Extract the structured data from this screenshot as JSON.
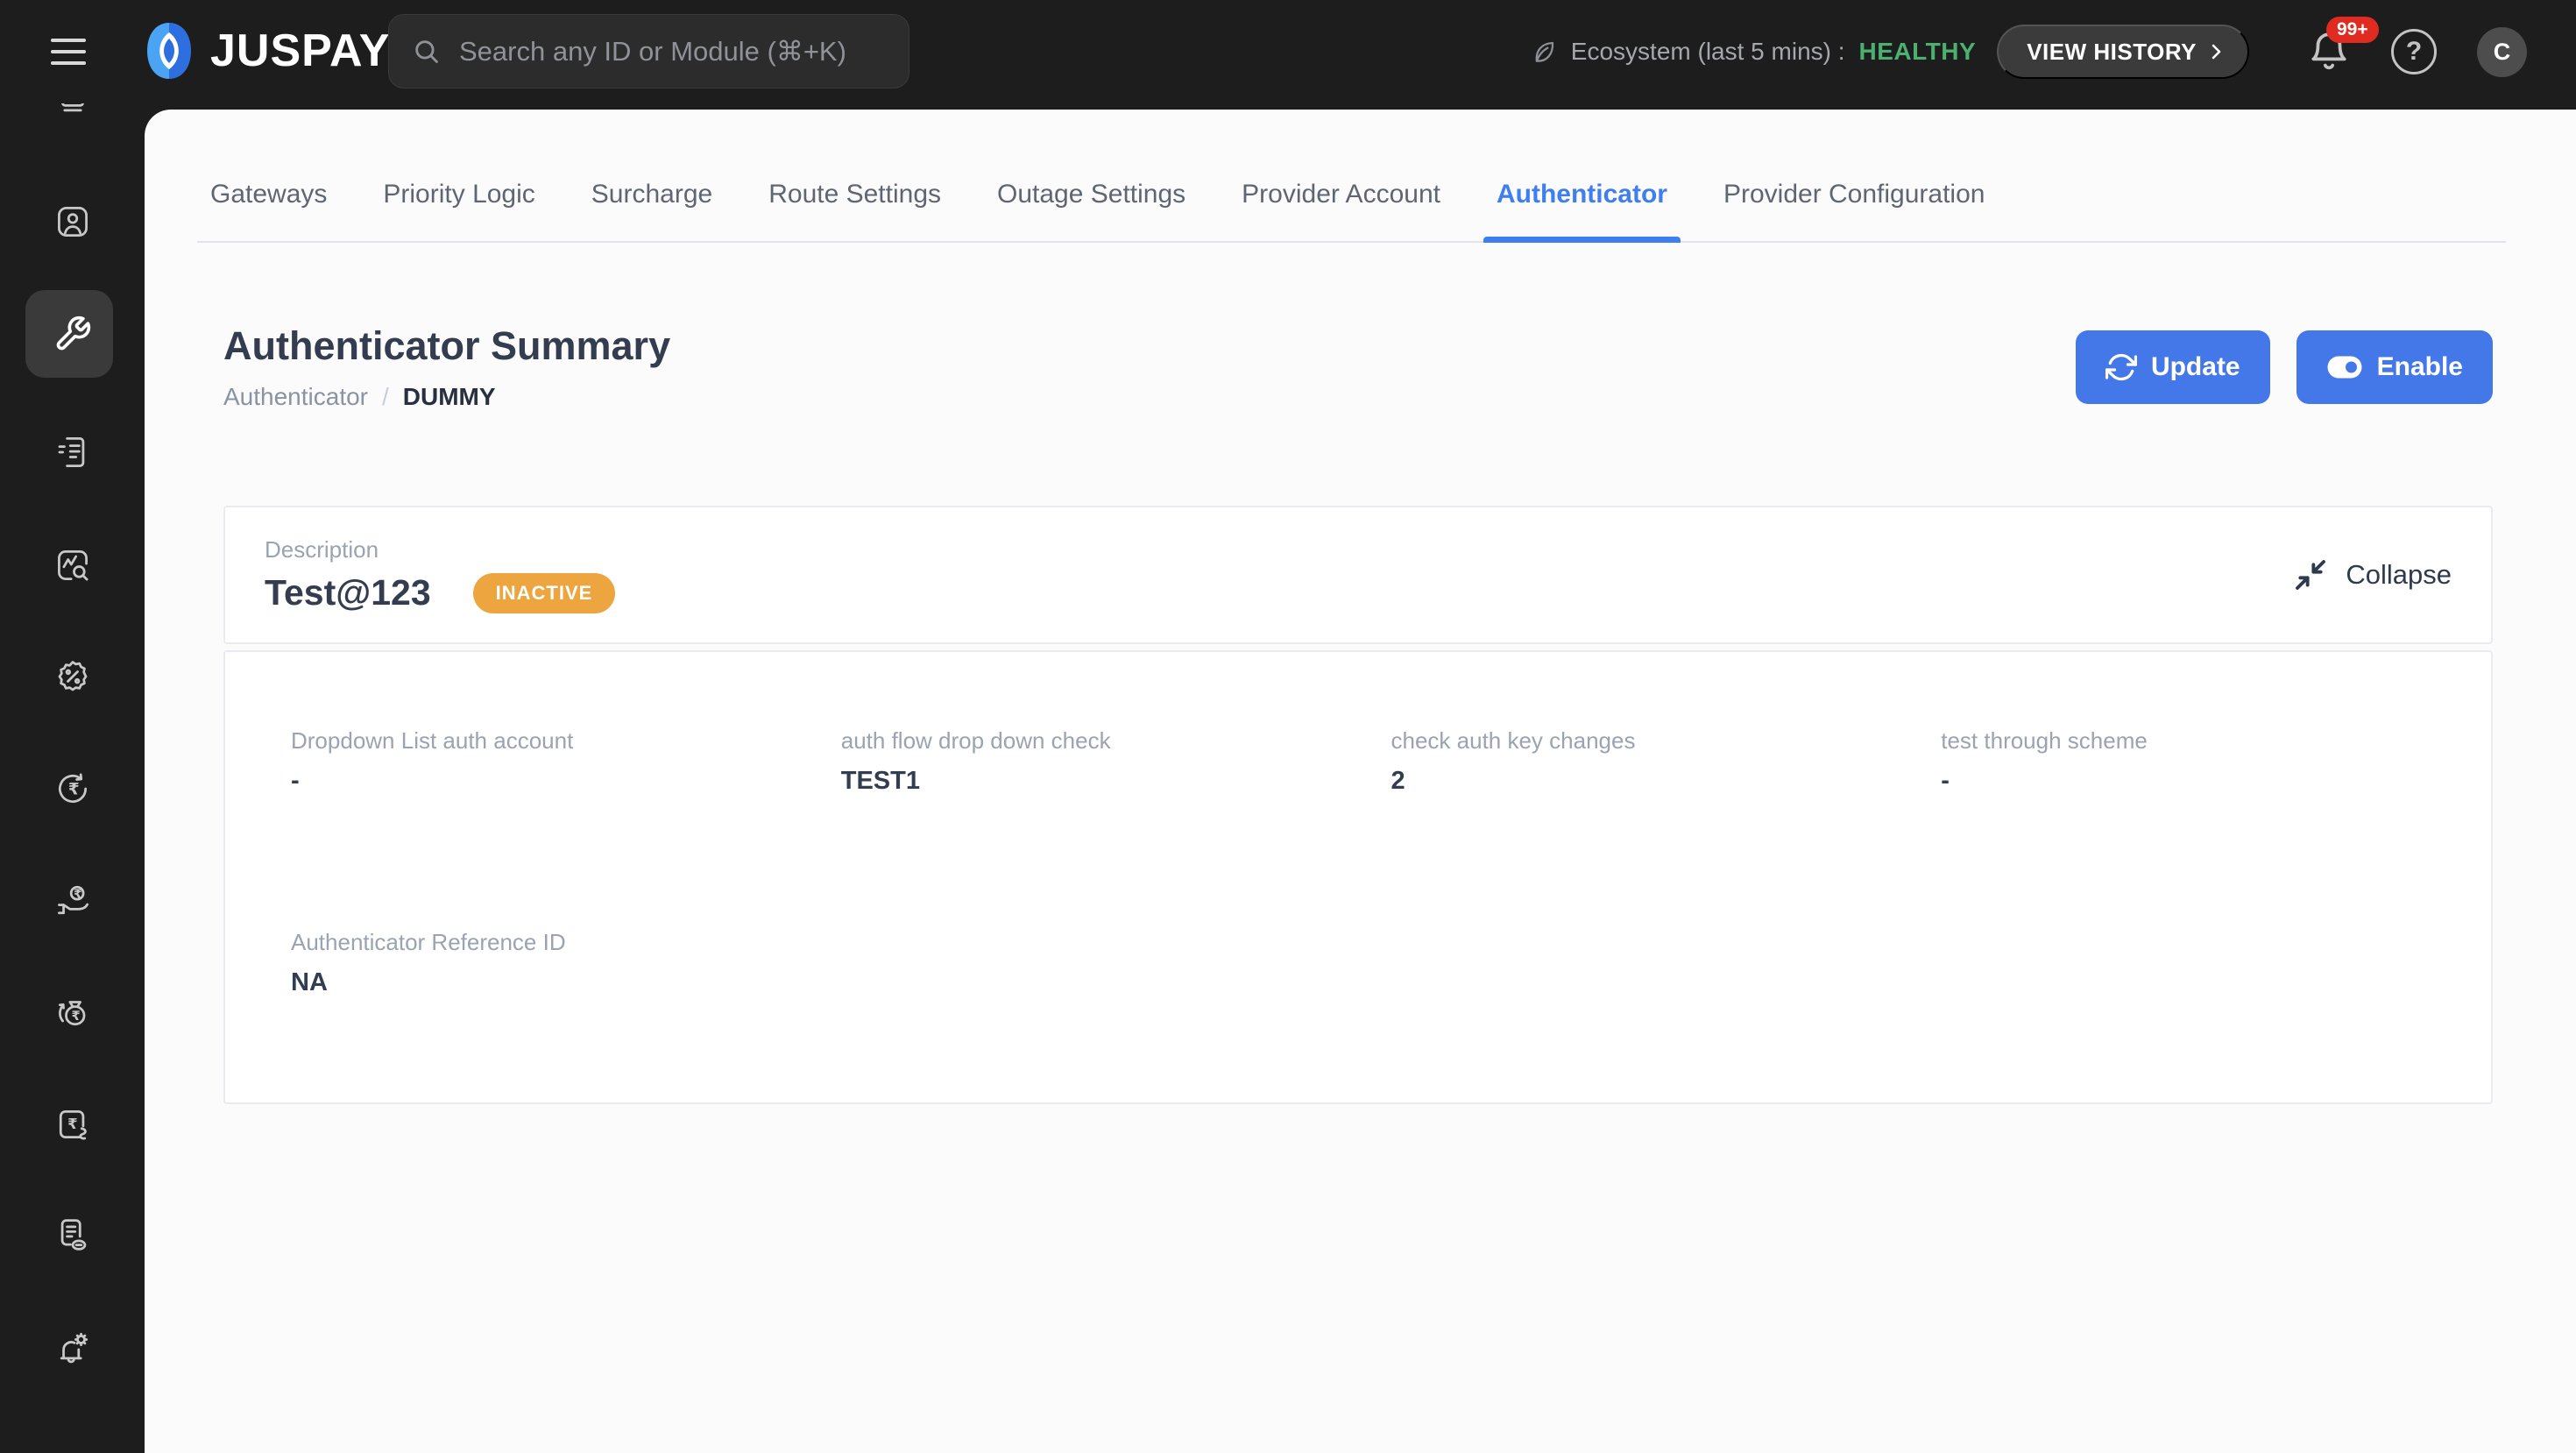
{
  "header": {
    "logo_text": "JUSPAY",
    "search": {
      "placeholder": "Search any ID or Module (⌘+K)"
    },
    "ecosystem": {
      "label": "Ecosystem (last 5 mins) :",
      "status": "HEALTHY",
      "view_history_label": "VIEW HISTORY"
    },
    "notifications_badge": "99+",
    "help_glyph": "?",
    "avatar_initial": "C"
  },
  "sidebar": {
    "items": [
      {
        "icon": "pos-terminal",
        "active": false
      },
      {
        "icon": "user-card",
        "active": false
      },
      {
        "icon": "wrench",
        "active": true
      },
      {
        "icon": "form-doc",
        "active": false
      },
      {
        "icon": "analytics-search",
        "active": false
      },
      {
        "icon": "percent-badge",
        "active": false
      },
      {
        "icon": "rupee-refresh",
        "active": false
      },
      {
        "icon": "hand-rupee",
        "active": false
      },
      {
        "icon": "money-bag-rupee",
        "active": false
      },
      {
        "icon": "rupee-doc-link",
        "active": false
      },
      {
        "icon": "doc-link",
        "active": false
      },
      {
        "icon": "bell-gear",
        "active": false
      }
    ]
  },
  "tabs": {
    "active": "Authenticator",
    "items": [
      {
        "label": "Gateways"
      },
      {
        "label": "Priority Logic"
      },
      {
        "label": "Surcharge"
      },
      {
        "label": "Route Settings"
      },
      {
        "label": "Outage Settings"
      },
      {
        "label": "Provider Account"
      },
      {
        "label": "Authenticator"
      },
      {
        "label": "Provider Configuration"
      }
    ]
  },
  "page": {
    "title": "Authenticator Summary",
    "breadcrumb": {
      "parent": "Authenticator",
      "separator": "/",
      "current": "DUMMY"
    },
    "actions": {
      "update_label": "Update",
      "enable_label": "Enable"
    }
  },
  "summary_card": {
    "description_label": "Description",
    "description_value": "Test@123",
    "status_badge": "INACTIVE",
    "collapse_label": "Collapse"
  },
  "fields": [
    {
      "label": "Dropdown List auth account",
      "value": "-"
    },
    {
      "label": "auth flow drop down check",
      "value": "TEST1"
    },
    {
      "label": "check auth key changes",
      "value": "2"
    },
    {
      "label": "test through scheme",
      "value": "-"
    },
    {
      "label": "Authenticator Reference ID",
      "value": "NA"
    }
  ],
  "colors": {
    "app_background": "#1d1d1d",
    "sheet_background": "#fbfbfb",
    "primary_blue": "#4478e9",
    "active_tab_blue": "#3f7ef0",
    "status_orange": "#eda53f",
    "healthy_green": "#4cb071",
    "badge_red": "#e02b20"
  }
}
